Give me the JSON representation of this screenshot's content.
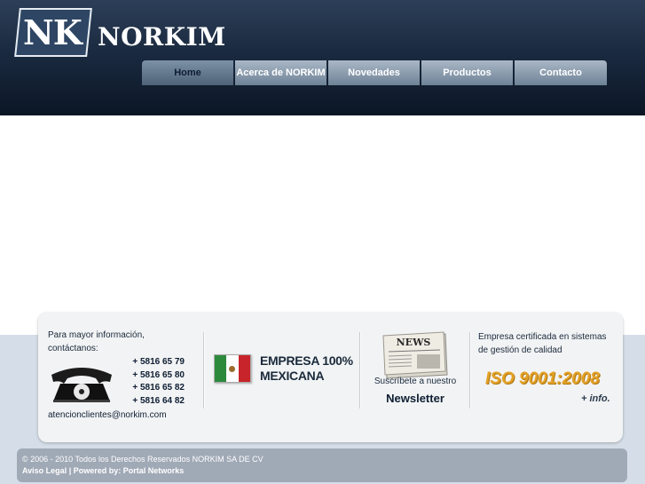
{
  "header": {
    "logo_mono": "NK",
    "logo_name": "NORKIM"
  },
  "nav": {
    "items": [
      {
        "label": "Home",
        "active": true
      },
      {
        "label": "Acerca de NORKIM"
      },
      {
        "label": "Novedades"
      },
      {
        "label": "Productos"
      },
      {
        "label": "Contacto"
      }
    ]
  },
  "info": {
    "contact_text": "Para mayor información, contáctanos:",
    "phones": [
      "+ 5816 65 79",
      "+ 5816 65 80",
      "+ 5816 65 82",
      "+ 5816 64 82"
    ],
    "email": "atencionclientes@norkim.com",
    "empresa_line1": "EMPRESA 100%",
    "empresa_line2": "MEXICANA",
    "news_label": "NEWS",
    "suscribete": "Suscríbete a nuestro",
    "newsletter": "Newsletter",
    "cert_text": "Empresa certificada en sistemas de gestión de calidad",
    "iso": "ISO 9001:2008",
    "more_info": "+ info."
  },
  "footer": {
    "copyright": "© 2006 - 2010 Todos los Derechos Reservados NORKIM SA DE CV",
    "aviso_legal": "Aviso Legal",
    "divider": "|",
    "powered_by": "Powered by: Portal Networks"
  },
  "colors": {
    "header_dark": "#0b1625",
    "nav_tab": "#8a9bb0",
    "iso_gold": "#e3a126",
    "page_bg": "#d5dee8"
  },
  "icons": [
    "telephone-icon",
    "mexican-flag-icon",
    "newspaper-icon"
  ]
}
